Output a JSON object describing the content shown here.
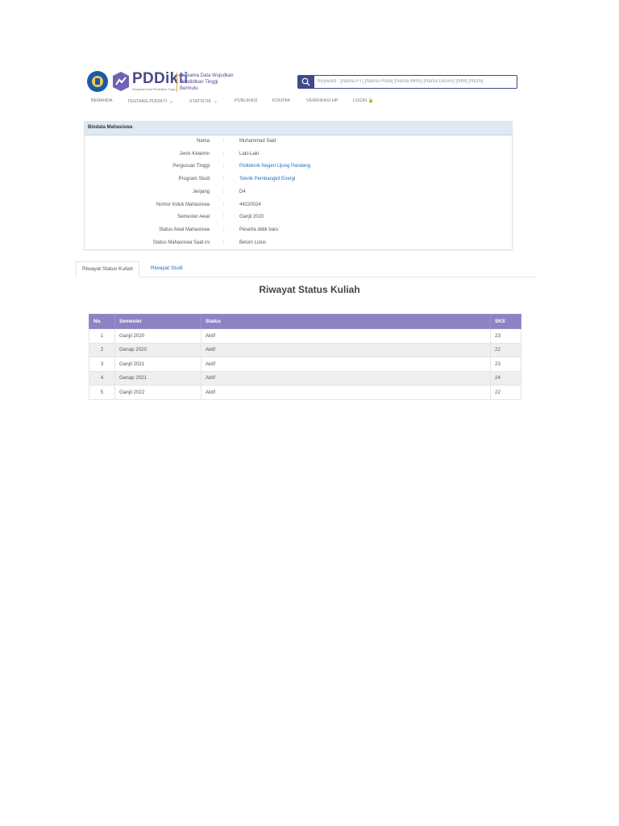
{
  "header": {
    "brand_main": "PDDik",
    "brand_accent": "ti",
    "brand_sub": "Pangkalan Data Pendidikan Tinggi",
    "tagline": "Bersama Data Wujudkan Pendidikan Tinggi Bermutu",
    "search_placeholder": "Keyword : [Nama PT] [Nama Prodi] [Nama MHS] [Nama Dosen] [NIM] [NIDN]",
    "search_icon": "search-icon",
    "colors": {
      "brand": "#4a4a8a",
      "accent": "#3f4a88",
      "header_bar": "#8e82c3"
    }
  },
  "nav": {
    "items": [
      "BERANDA",
      "TENTANG PDDIKTI",
      "STATISTIK",
      "PUBLIKASI",
      "KONTAK",
      "VERIFIKASI HP",
      "LOGIN"
    ]
  },
  "biodata": {
    "title": "Biodata Mahasiswa",
    "rows": [
      {
        "label": "Nama",
        "value": "Muhammad Said"
      },
      {
        "label": "Jenis Kelamin",
        "value": "Laki-Laki"
      },
      {
        "label": "Perguruan Tinggi",
        "value": "Politeknik Negeri Ujung Pandang"
      },
      {
        "label": "Program Studi",
        "value": "Teknik Pembangkit Energi"
      },
      {
        "label": "Jenjang",
        "value": "D4"
      },
      {
        "label": "Nomor Induk Mahasiswa",
        "value": "44220024"
      },
      {
        "label": "Semester Awal",
        "value": "Ganjil 2020"
      },
      {
        "label": "Status Awal Mahasiswa",
        "value": "Peserta didik baru"
      },
      {
        "label": "Status Mahasiswa Saat ini",
        "value": "Belum Lulus"
      }
    ]
  },
  "tabs": {
    "active": "Riwayat Status Kuliah",
    "inactive": "Riwayat Studi"
  },
  "riwayat": {
    "title": "Riwayat Status Kuliah",
    "headers": [
      "No.",
      "Semester",
      "Status",
      "SKS"
    ],
    "rows": [
      [
        "1",
        "Ganjil 2020",
        "Aktif",
        "23"
      ],
      [
        "2",
        "Genap 2020",
        "Aktif",
        "22"
      ],
      [
        "3",
        "Ganjil 2021",
        "Aktif",
        "23"
      ],
      [
        "4",
        "Genap 2021",
        "Aktif",
        "24"
      ],
      [
        "5",
        "Ganjil 2022",
        "Aktif",
        "22"
      ]
    ]
  }
}
